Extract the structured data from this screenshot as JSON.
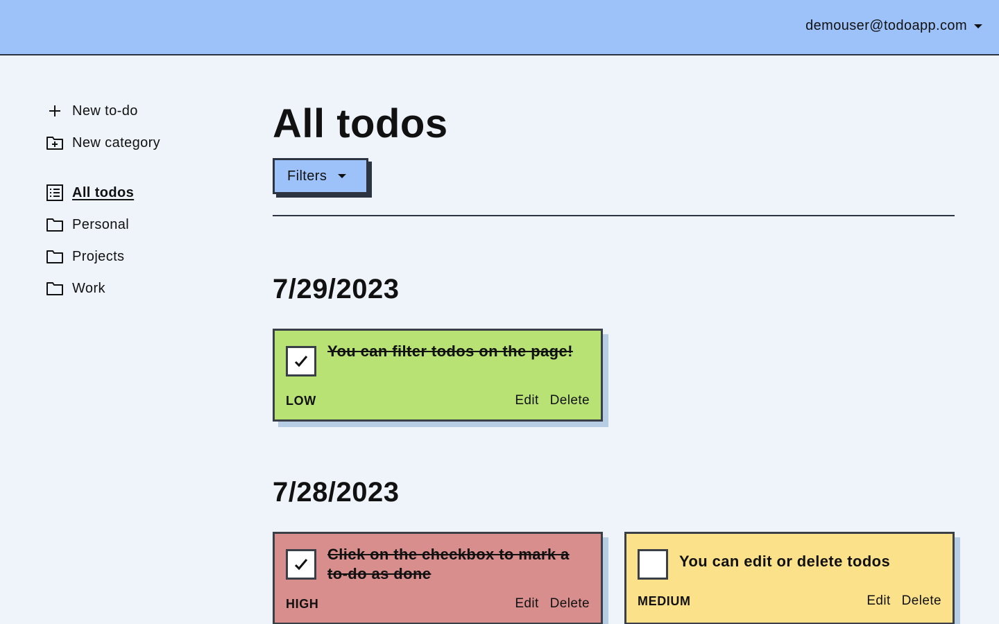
{
  "header": {
    "user_email": "demouser@todoapp.com"
  },
  "sidebar": {
    "actions": [
      {
        "label": "New to-do",
        "icon": "plus-icon"
      },
      {
        "label": "New category",
        "icon": "folder-plus-icon"
      }
    ],
    "items": [
      {
        "label": "All todos",
        "icon": "list-icon",
        "active": true
      },
      {
        "label": "Personal",
        "icon": "folder-icon"
      },
      {
        "label": "Projects",
        "icon": "folder-icon"
      },
      {
        "label": "Work",
        "icon": "folder-icon"
      }
    ]
  },
  "main": {
    "title": "All todos",
    "filters_label": "Filters",
    "groups": [
      {
        "date": "7/29/2023",
        "todos": [
          {
            "title": "You can filter todos on the page!",
            "priority": "LOW",
            "done": true,
            "color": "#b8e274"
          }
        ]
      },
      {
        "date": "7/28/2023",
        "todos": [
          {
            "title": "Click on the checkbox to mark a to-do as done",
            "priority": "HIGH",
            "done": true,
            "color": "#d98e8e"
          },
          {
            "title": "You can edit or delete todos",
            "priority": "MEDIUM",
            "done": false,
            "color": "#fbe28a"
          }
        ]
      }
    ],
    "edit_label": "Edit",
    "delete_label": "Delete"
  },
  "colors": {
    "header_bg": "#9dc2fa",
    "page_bg": "#eff4fa",
    "border": "#2b3440"
  }
}
